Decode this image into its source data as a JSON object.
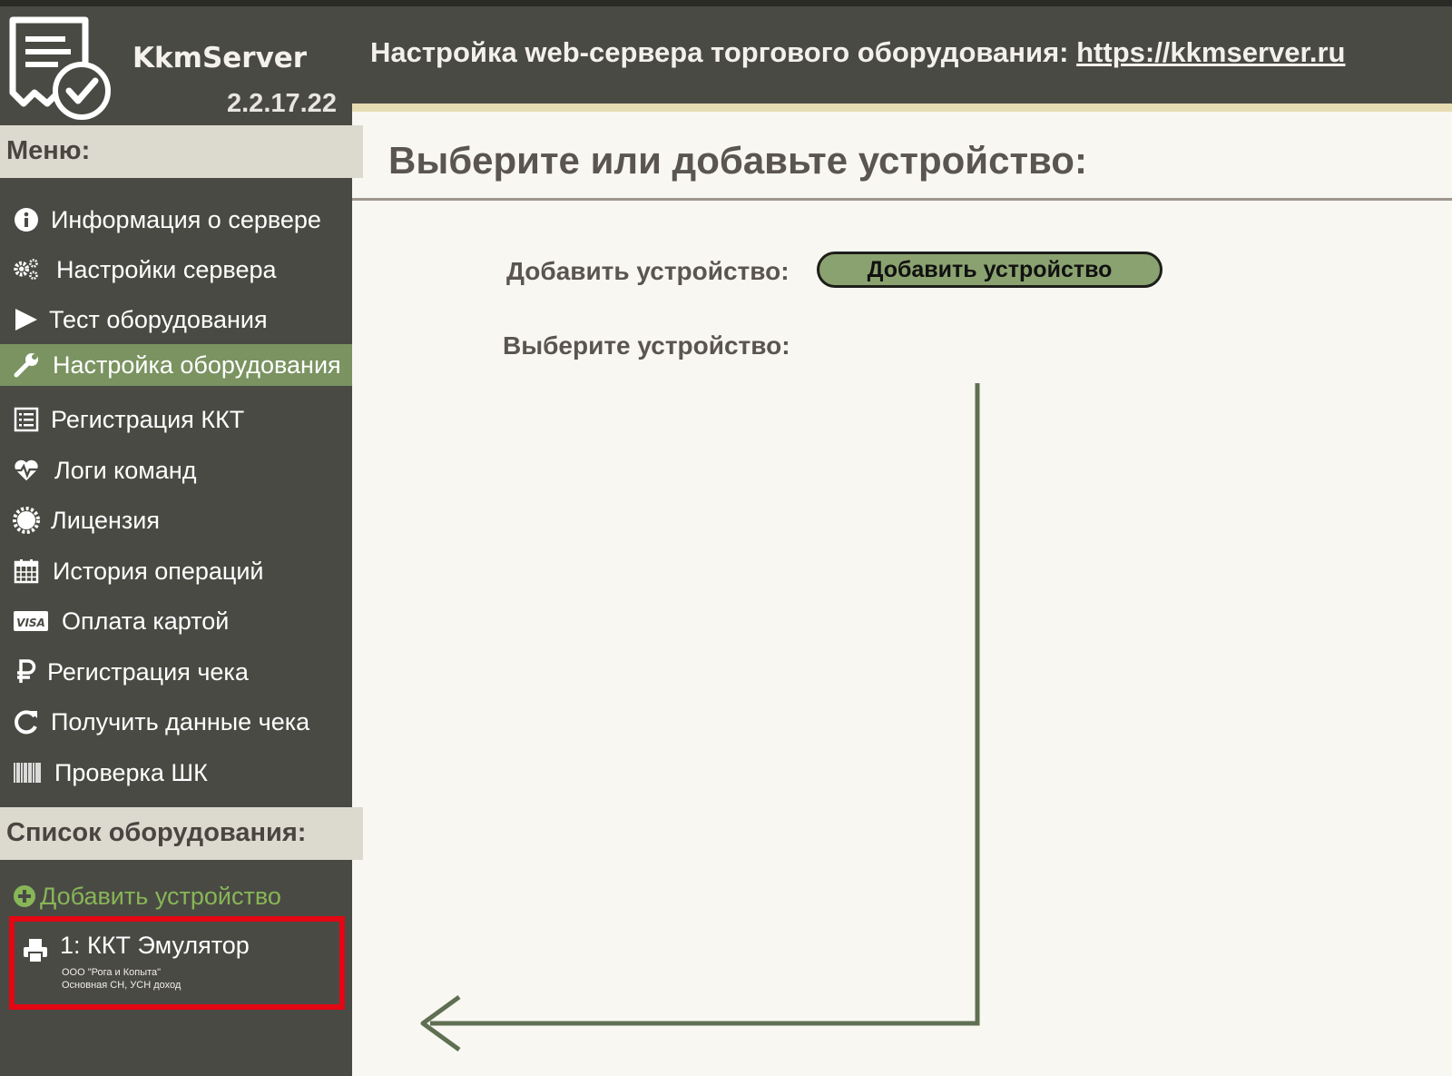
{
  "app": {
    "name": "KkmServer",
    "version": "2.2.17.22"
  },
  "header": {
    "title": "Настройка web-сервера торгового оборудования: ",
    "link_text": "https://kkmserver.ru"
  },
  "sidebar": {
    "menu_heading": "Меню:",
    "items": [
      {
        "label": "Информация о сервере",
        "icon": "info-icon"
      },
      {
        "label": "Настройки сервера",
        "icon": "gears-icon"
      },
      {
        "label": "Тест оборудования",
        "icon": "play-icon"
      },
      {
        "label": "Настройка оборудования",
        "icon": "wrench-icon",
        "active": true
      },
      {
        "label": "Регистрация ККТ",
        "icon": "list-icon"
      },
      {
        "label": "Логи команд",
        "icon": "heartbeat-icon"
      },
      {
        "label": "Лицензия",
        "icon": "certificate-icon"
      },
      {
        "label": "История операций",
        "icon": "calendar-icon"
      },
      {
        "label": "Оплата картой",
        "icon": "visa-card-icon"
      },
      {
        "label": "Регистрация чека",
        "icon": "ruble-icon"
      },
      {
        "label": "Получить данные чека",
        "icon": "refresh-icon"
      },
      {
        "label": "Проверка ШК",
        "icon": "barcode-icon"
      }
    ],
    "equipment_heading": "Список оборудования:",
    "add_device_label": "Добавить устройство",
    "devices": [
      {
        "name": "1: ККТ Эмулятор",
        "org": "ООО \"Рога и Копыта\"",
        "tax": "Основная СН, УСН доход",
        "icon": "printer-icon"
      }
    ]
  },
  "main": {
    "title": "Выберите или добавьте устройство:",
    "add_label": "Добавить устройство:",
    "add_button": "Добавить устройство",
    "choose_label": "Выберите устройство:"
  },
  "colors": {
    "sidebar_bg": "#4a4a44",
    "active_item": "#7a9361",
    "button_green": "#8aa26f",
    "highlight_red": "#e30613",
    "content_bg": "#f8f7f1",
    "add_link_green": "#87b657"
  }
}
